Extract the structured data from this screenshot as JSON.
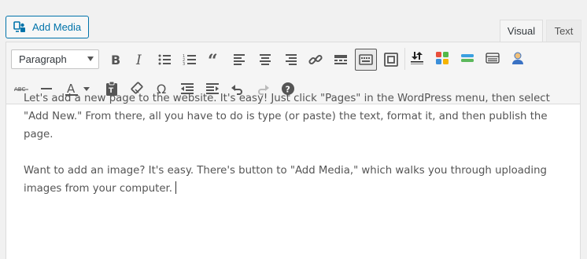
{
  "add_media": {
    "label": "Add Media",
    "icon": "add-media-icon"
  },
  "tabs": [
    {
      "label": "Visual",
      "active": true
    },
    {
      "label": "Text",
      "active": false
    }
  ],
  "toolbar": {
    "format_select": {
      "value": "Paragraph"
    },
    "row1_icons": [
      "bold-icon",
      "italic-icon",
      "bullet-list-icon",
      "numbered-list-icon",
      "blockquote-icon",
      "align-left-icon",
      "align-center-icon",
      "align-right-icon",
      "link-icon",
      "read-more-icon",
      "toolbar-toggle-icon",
      "fullscreen-icon",
      "insert-page-break-icon",
      "grid-blocks-icon",
      "insert-shortcode-icon",
      "insert-table-icon",
      "insert-user-icon"
    ],
    "row2_icons": [
      "strikethrough-icon",
      "horizontal-line-icon",
      "text-color-icon",
      "paste-text-icon",
      "clear-formatting-icon",
      "special-character-icon",
      "outdent-icon",
      "indent-icon",
      "undo-icon",
      "redo-icon",
      "help-icon"
    ],
    "strikethrough_label": "ABC",
    "text_color_label": "A",
    "special_char": "Ω",
    "help": "?"
  },
  "content": {
    "paragraphs": [
      "Let's add a new page to the website. It's easy! Just click \"Pages\" in the WordPress menu, then select \"Add New.\" From there, all you have to do is type (or paste) the text, format it, and then publish the page.",
      "Want to add an image? It's easy. There's button to \"Add Media,\" which walks you through uploading images from your computer."
    ]
  },
  "colors": {
    "accent": "#0073aa",
    "toolbar_bg": "#f5f5f5",
    "text": "#555555"
  }
}
